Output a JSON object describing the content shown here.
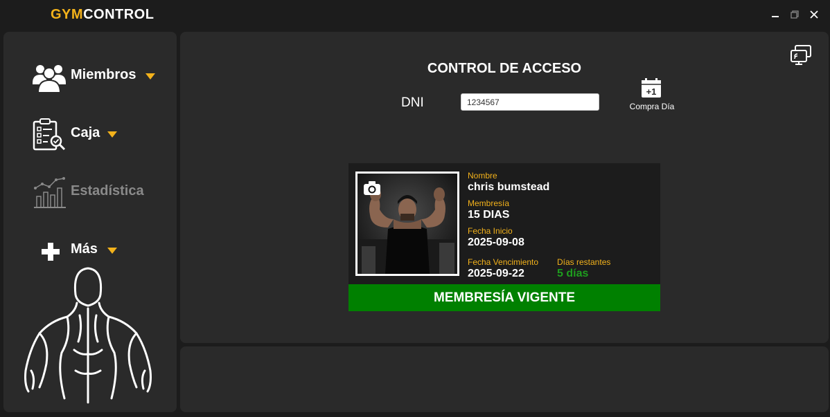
{
  "app": {
    "logo_part1": "GYM",
    "logo_part2": "CONTROL",
    "colors": {
      "accent": "#f3b21b",
      "background": "#1c1c1c",
      "panel": "#2a2a2a",
      "status_ok": "#008000"
    }
  },
  "window_controls": {
    "minimize_icon": "minimize-icon",
    "restore_icon": "restore-icon",
    "close_icon": "close-icon"
  },
  "sidebar": {
    "items": [
      {
        "label": "Miembros",
        "icon": "members-icon",
        "enabled": true
      },
      {
        "label": "Caja",
        "icon": "cashbox-icon",
        "enabled": true
      },
      {
        "label": "Estadística",
        "icon": "statistics-icon",
        "enabled": false
      },
      {
        "label": "Más",
        "icon": "plus-icon",
        "enabled": true
      }
    ]
  },
  "access": {
    "title": "CONTROL DE ACCESO",
    "dni_label": "DNI",
    "dni_value": "1234567",
    "compra_label": "Compra Día",
    "compra_icon_text": "+1"
  },
  "member": {
    "nombre_label": "Nombre",
    "nombre": "chris bumstead",
    "membresia_label": "Membresía",
    "membresia": "15 DIAS",
    "fecha_inicio_label": "Fecha Inicio",
    "fecha_inicio": "2025-09-08",
    "fecha_venc_label": "Fecha Vencimiento",
    "fecha_venc": "2025-09-22",
    "dias_label": "Días restantes",
    "dias": "5 días",
    "status": "MEMBRESÍA VIGENTE"
  }
}
